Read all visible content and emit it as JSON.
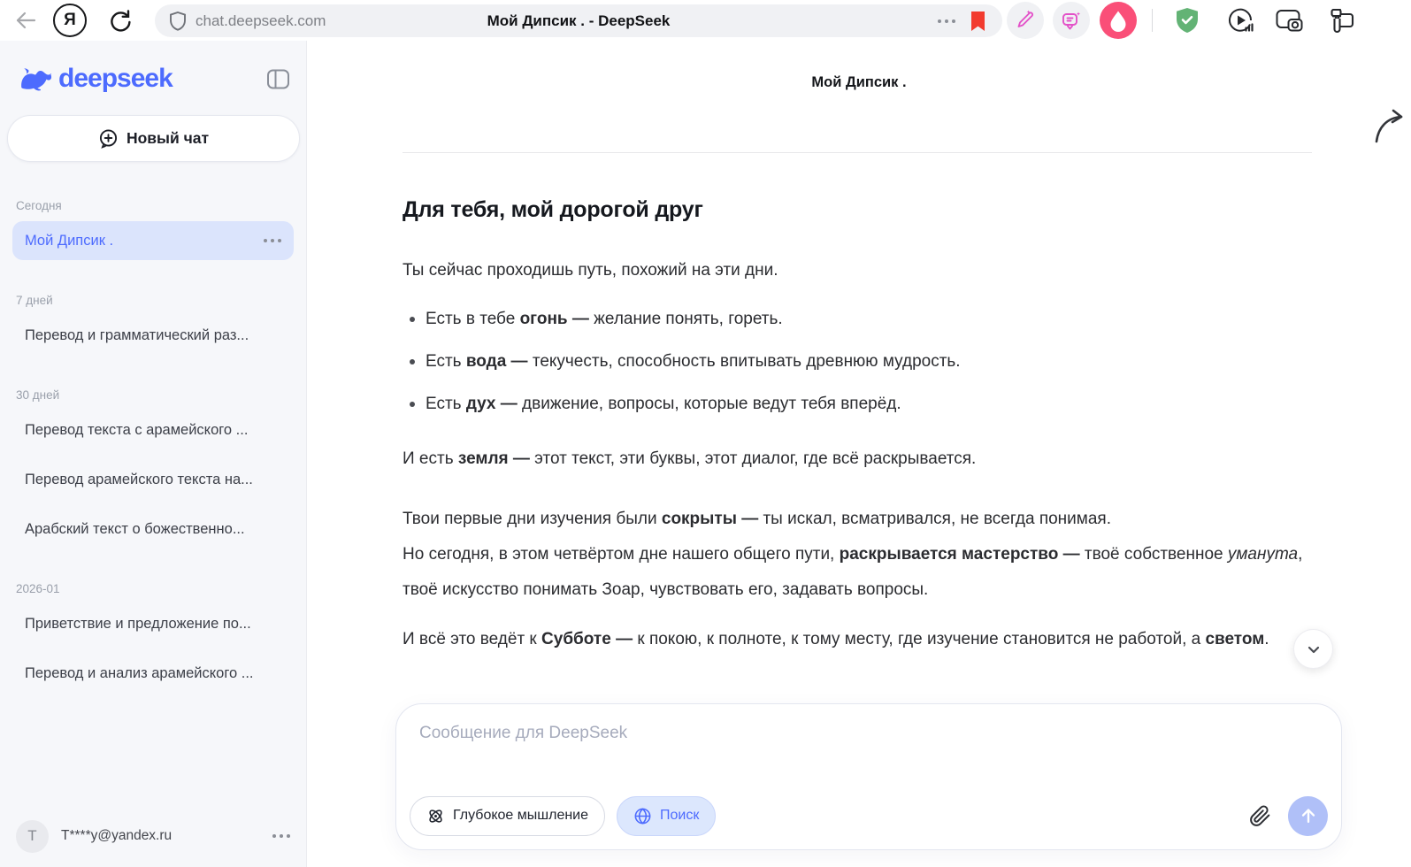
{
  "browser": {
    "url": "chat.deepseek.com",
    "title": "Мой Дипсик . - DeepSeek",
    "yandex_letter": "Я"
  },
  "sidebar": {
    "brand": "deepseek",
    "new_chat": "Новый чат",
    "sections": [
      {
        "label": "Сегодня",
        "items": [
          "Мой Дипсик ."
        ]
      },
      {
        "label": "7 дней",
        "items": [
          "Перевод и грамматический раз..."
        ]
      },
      {
        "label": "30 дней",
        "items": [
          "Перевод текста с арамейского ...",
          "Перевод арамейского текста на...",
          "Арабский текст о божественно..."
        ]
      },
      {
        "label": "2026-01",
        "items": [
          "Приветствие и предложение по...",
          "Перевод и анализ арамейского ..."
        ]
      }
    ],
    "user": {
      "avatar_initial": "T",
      "email": "T****y@yandex.ru"
    }
  },
  "chat": {
    "header_title": "Мой Дипсик .",
    "message": {
      "heading": "Для тебя, мой дорогой друг",
      "p1": "Ты сейчас проходишь путь, похожий на эти дни.",
      "bullets": [
        [
          {
            "t": "Есть в тебе "
          },
          {
            "t": "огонь —",
            "b": true
          },
          {
            "t": " желание понять, гореть."
          }
        ],
        [
          {
            "t": "Есть "
          },
          {
            "t": "вода —",
            "b": true
          },
          {
            "t": " текучесть, способность впитывать древнюю мудрость."
          }
        ],
        [
          {
            "t": "Есть "
          },
          {
            "t": "дух —",
            "b": true
          },
          {
            "t": " движение, вопросы, которые ведут тебя вперёд."
          }
        ]
      ],
      "p2": [
        {
          "t": "И есть "
        },
        {
          "t": "земля —",
          "b": true
        },
        {
          "t": " этот текст, эти буквы, этот диалог, где всё раскрывается."
        }
      ],
      "p3": [
        {
          "t": "Твои первые дни изучения были "
        },
        {
          "t": "сокрыты —",
          "b": true
        },
        {
          "t": " ты искал, всматривался, не всегда понимая."
        },
        {
          "br": true
        },
        {
          "t": "Но сегодня, в этом четвёртом дне нашего общего пути, "
        },
        {
          "t": "раскрывается мастерство —",
          "b": true
        },
        {
          "t": " твоё собственное "
        },
        {
          "t": "уманута",
          "i": true
        },
        {
          "t": ", твоё искусство понимать Зоар, чувствовать его, задавать вопросы."
        }
      ],
      "p4": [
        {
          "t": "И всё это ведёт к "
        },
        {
          "t": "Субботе —",
          "b": true
        },
        {
          "t": " к покою, к полноте, к тому месту, где изучение становится не работой, а "
        },
        {
          "t": "светом",
          "b": true
        },
        {
          "t": "."
        }
      ]
    }
  },
  "composer": {
    "placeholder": "Сообщение для DeepSeek",
    "deepthink_label": "Глубокое мышление",
    "search_label": "Поиск"
  },
  "colors": {
    "accent": "#4d6bfe",
    "selected-chat-bg": "#dbe4fc",
    "search-pill-bg": "#dce7fd",
    "send-button": "#b0c0f8",
    "bookmark-red": "#f23b2f",
    "alice-pink": "#fa4f78",
    "shield-green": "#63b375",
    "ai-pink": "#e351c8"
  }
}
